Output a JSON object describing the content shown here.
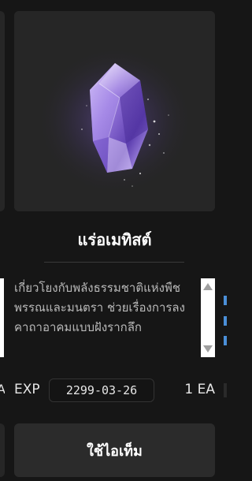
{
  "item": {
    "name": "แร่อเมทิสต์",
    "description": "เกี่ยวโยงกับพลังธรรมชาติแห่งพืชพรรณและมนตรา ช่วยเรื่องการลงคาถาอาคมแบบฝังรากลึก",
    "description_lines": "เกี่ยวโยงกับพลังธรรมชาติแห่งพืช\nพรรณและมนตรา ช่วยเรื่องการลง\nคาถาอาคมแบบฝังรากลึก",
    "image_icon": "amethyst-crystal-icon",
    "crystal_color": "#8b6fd6",
    "glow_color": "#6a4fa8"
  },
  "exp": {
    "label": "EXP",
    "date": "2299-03-26"
  },
  "quantity": "1 EA",
  "use_button_label": "ใช้ไอเท็ม",
  "left_neighbor_exp_fragment": "A"
}
